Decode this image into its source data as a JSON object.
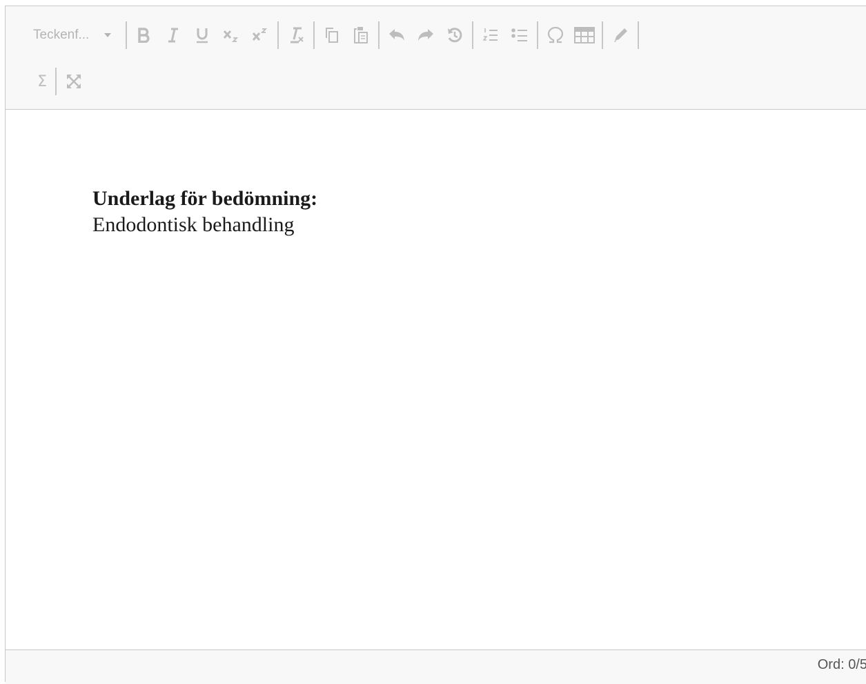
{
  "toolbar": {
    "font_select_label": "Teckenf...",
    "sum_label": "Σ"
  },
  "content": {
    "heading": "Underlag för bedömning:",
    "body": "Endodontisk behandling"
  },
  "statusbar": {
    "word_count": "Ord: 0/5"
  }
}
